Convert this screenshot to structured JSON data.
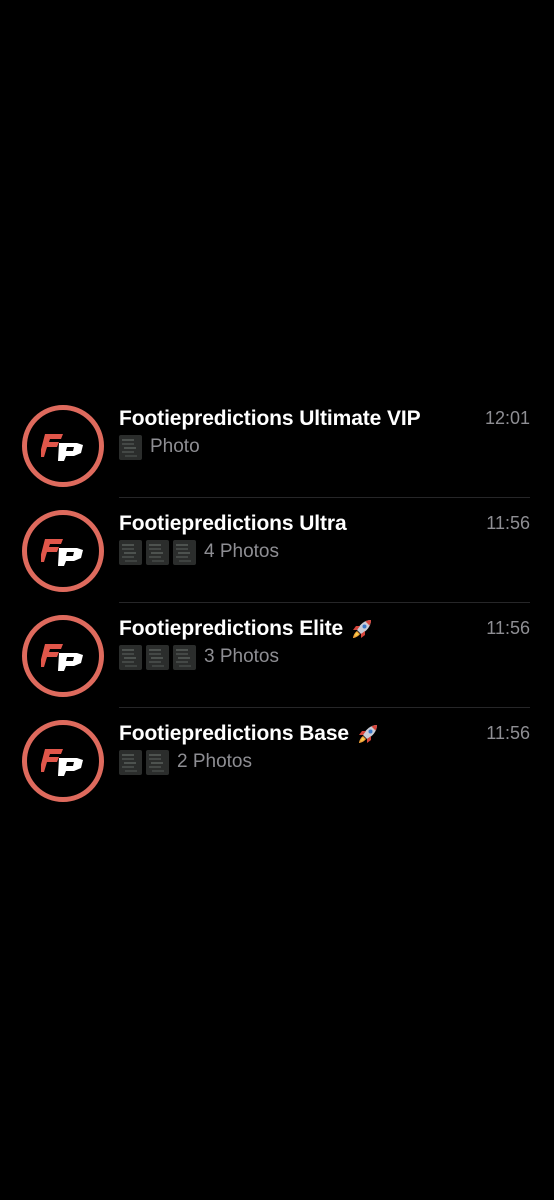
{
  "chats": [
    {
      "title": "Footiepredictions Ultimate VIP",
      "time": "12:01",
      "preview": "Photo",
      "thumbnail_count": 1,
      "has_rocket": false,
      "avatar_icon": "fp-logo-icon"
    },
    {
      "title": "Footiepredictions Ultra",
      "time": "11:56",
      "preview": "4 Photos",
      "thumbnail_count": 3,
      "has_rocket": false,
      "avatar_icon": "fp-logo-icon"
    },
    {
      "title": "Footiepredictions Elite",
      "time": "11:56",
      "preview": "3 Photos",
      "thumbnail_count": 3,
      "has_rocket": true,
      "avatar_icon": "fp-logo-icon"
    },
    {
      "title": "Footiepredictions Base",
      "time": "11:56",
      "preview": "2 Photos",
      "thumbnail_count": 2,
      "has_rocket": true,
      "avatar_icon": "fp-logo-icon"
    }
  ],
  "colors": {
    "background": "#000000",
    "avatar_ring": "#de6a5d",
    "title": "#ffffff",
    "secondary_text": "#8e8e93"
  }
}
